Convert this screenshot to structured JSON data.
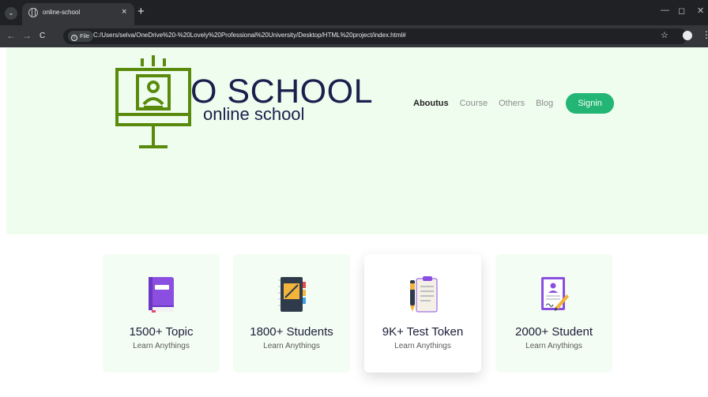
{
  "browser": {
    "tab_title": "online-school",
    "tab_close": "×",
    "new_tab": "+",
    "menu_glyph": "⌄",
    "back": "←",
    "forward": "→",
    "reload": "C",
    "info_chip_label": "File",
    "url": "C:/Users/selva/OneDrive%20-%20Lovely%20Professional%20University/Desktop/HTML%20project/index.html#",
    "star": "☆",
    "kebab": "⋮",
    "minimize": "—",
    "restore": "◻",
    "close": "✕"
  },
  "brand": {
    "name": "O SCHOOL",
    "tagline": "online school",
    "logo_color": "#5a8a0c",
    "text_color": "#1a1f4d"
  },
  "nav": {
    "items": [
      {
        "label": "Aboutus",
        "active": true
      },
      {
        "label": "Course",
        "active": false
      },
      {
        "label": "Others",
        "active": false
      },
      {
        "label": "Blog",
        "active": false
      }
    ],
    "signin_label": "Signin",
    "signin_color": "#22b573"
  },
  "hero": {
    "background": "#effdef"
  },
  "cards": [
    {
      "title": "1500+ Topic",
      "subtitle": "Learn Anythings",
      "icon": "book-icon"
    },
    {
      "title": "1800+ Students",
      "subtitle": "Learn Anythings",
      "icon": "notebook-icon"
    },
    {
      "title": "9K+ Test Token",
      "subtitle": "Learn Anythings",
      "icon": "clipboard-pen-icon"
    },
    {
      "title": "2000+ Student",
      "subtitle": "Learn Anythings",
      "icon": "certificate-icon"
    }
  ]
}
